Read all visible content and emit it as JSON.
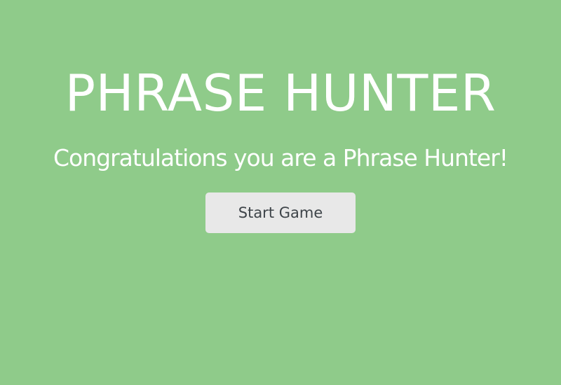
{
  "app": {
    "title": "PHRASE HUNTER"
  },
  "overlay": {
    "message": "Congratulations you are a Phrase Hunter!",
    "start_button_label": "Start Game"
  },
  "colors": {
    "background": "#8fcb8a",
    "text": "#ffffff",
    "button_background": "#e8e8e8",
    "button_text": "#3e4449"
  }
}
